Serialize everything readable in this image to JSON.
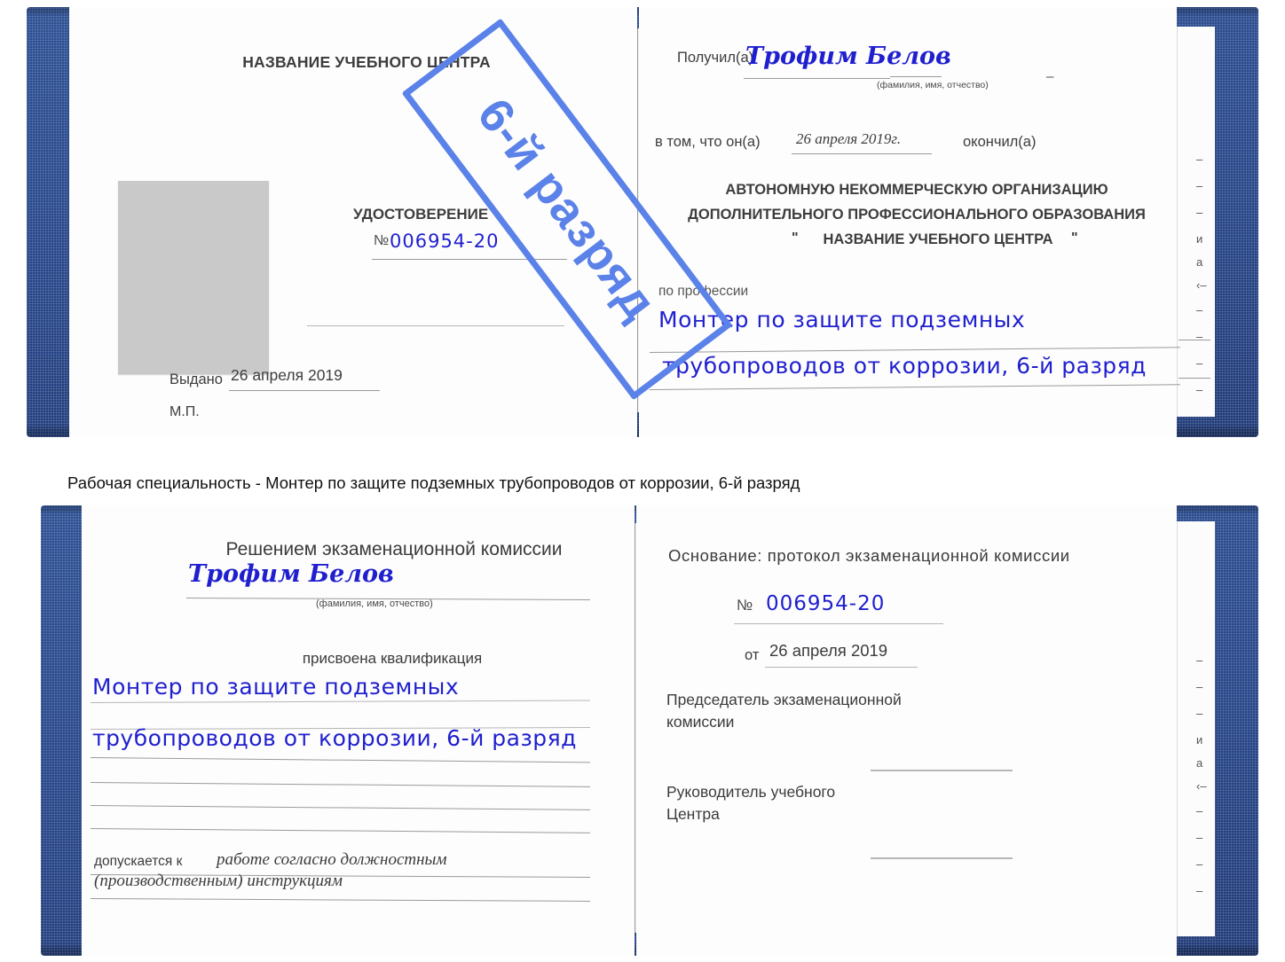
{
  "caption": {
    "text": "Рабочая специальность - Монтер по защите подземных трубопроводов от коррозии, 6-й разряд"
  },
  "stamp": {
    "label": "6-й разряд",
    "color": "#5b82e8"
  },
  "colors": {
    "cover_blue": "#27468a",
    "handwriting_blue": "#1f1fcf",
    "print_gray": "#4a4a4a",
    "photo_gray": "#c9c9c9",
    "rule_gray": "#9a9a9a"
  },
  "certificate_front": {
    "left_page": {
      "org_title": "НАЗВАНИЕ УЧЕБНОГО ЦЕНТРА",
      "doc_type": "УДОСТОВЕРЕНИЕ",
      "number_symbol": "№",
      "number_value": "006954-20",
      "issued_label": "Выдано",
      "issued_value": "26 апреля 2019",
      "seal_label": "М.П.",
      "photo_placeholder": "photo-placeholder"
    },
    "right_page": {
      "received_label": "Получил(а)",
      "received_value": "Трофим Белов",
      "fio_hint": "(фамилия, имя, отчество)",
      "that_he_label": "в том, что он(а)",
      "that_he_value": "26 апреля 2019г.",
      "finished_label": "окончил(а)",
      "org_line1": "АВТОНОМНУЮ НЕКОММЕРЧЕСКУЮ ОРГАНИЗАЦИЮ",
      "org_line2": "ДОПОЛНИТЕЛЬНОГО ПРОФЕССИОНАЛЬНОГО ОБРАЗОВАНИЯ",
      "org_quote_open": "\"",
      "org_line3": "НАЗВАНИЕ УЧЕБНОГО ЦЕНТРА",
      "org_quote_close": "\"",
      "profession_label": "по профессии",
      "profession_line1": "Монтер по защите подземных",
      "profession_line2": "трубопроводов от коррозии, 6-й разряд"
    },
    "edge_sliver_chars": [
      "–",
      "–",
      "–",
      "и",
      "а",
      "‹–",
      "–",
      "–",
      "–",
      "–"
    ]
  },
  "certificate_inside": {
    "left_page": {
      "heading": "Решением экзаменационной комиссии",
      "name_value": "Трофим Белов",
      "fio_hint": "(фамилия, имя, отчество)",
      "qualification_label": "присвоена квалификация",
      "qualification_line1": "Монтер по защите подземных",
      "qualification_line2": "трубопроводов от коррозии, 6-й разряд",
      "admitted_label": "допускается к",
      "admitted_line1": "работе согласно должностным",
      "admitted_line2": "(производственным) инструкциям"
    },
    "right_page": {
      "basis_label": "Основание: протокол экзаменационной комиссии",
      "number_symbol": "№",
      "number_value": "006954-20",
      "from_label": "от",
      "from_value": "26 апреля 2019",
      "chairman_line1": "Председатель экзаменационной",
      "chairman_line2": "комиссии",
      "head_line1": "Руководитель учебного",
      "head_line2": "Центра"
    },
    "edge_sliver_chars": [
      "–",
      "–",
      "–",
      "и",
      "а",
      "‹–",
      "–",
      "–",
      "–",
      "–"
    ]
  }
}
